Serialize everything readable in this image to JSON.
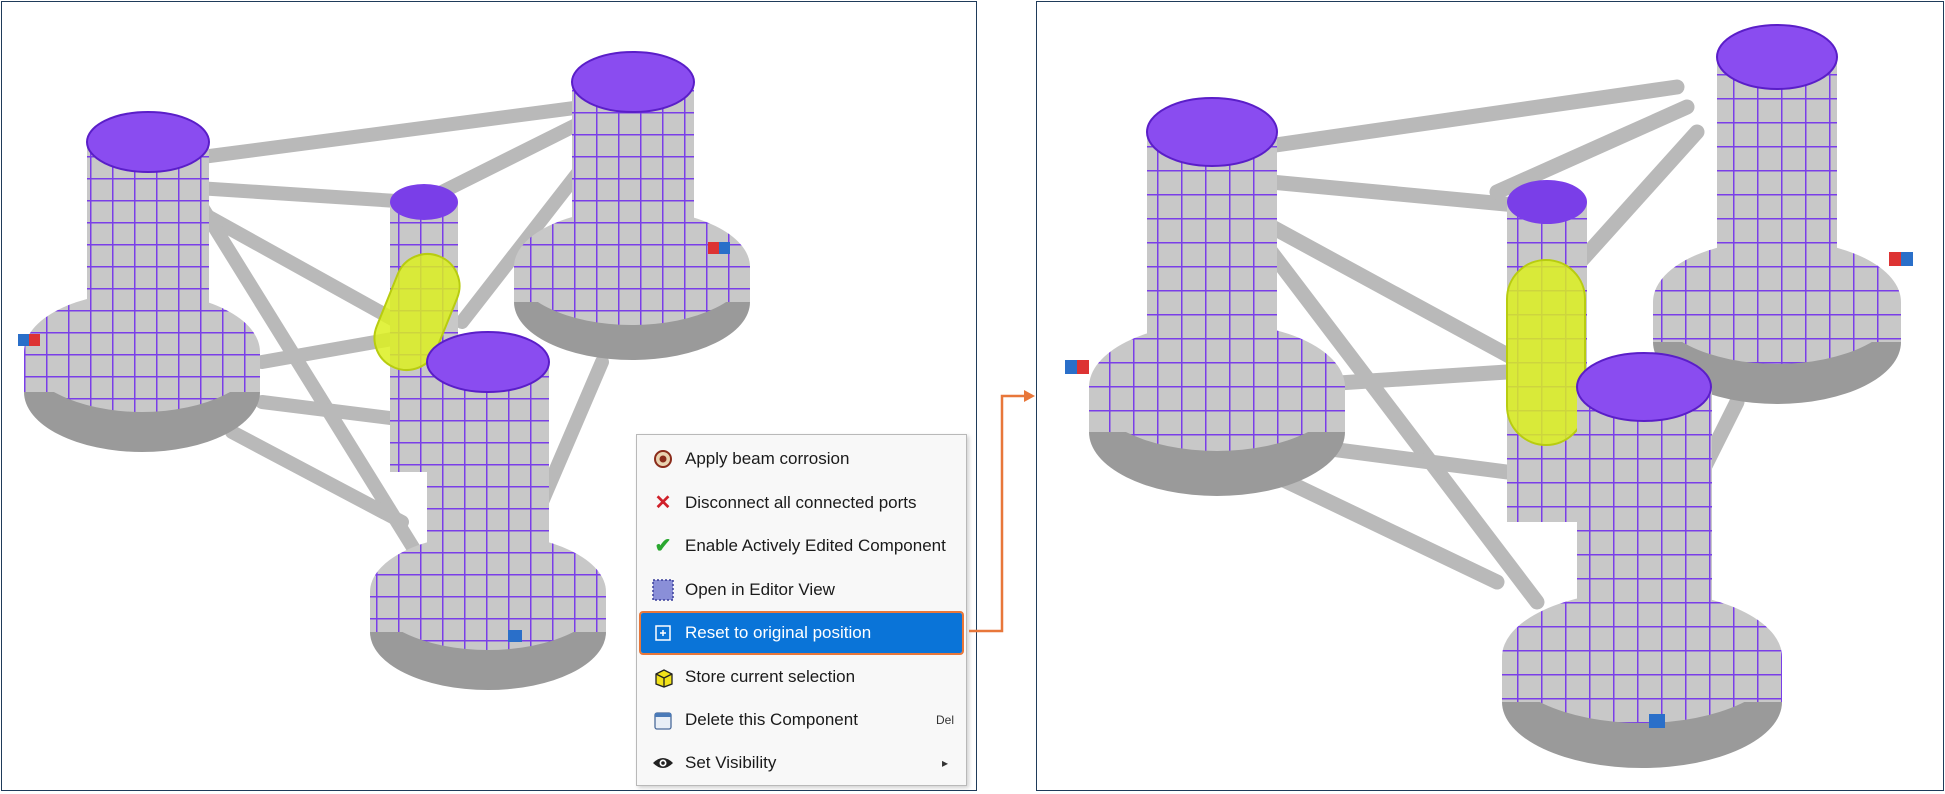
{
  "context_menu": {
    "items": [
      {
        "label": "Apply beam corrosion",
        "icon": "corrosion-icon"
      },
      {
        "label": "Disconnect all connected ports",
        "icon": "close-x-icon"
      },
      {
        "label": "Enable Actively Edited Component",
        "icon": "checkmark-icon"
      },
      {
        "label": "Open in Editor View",
        "icon": "editor-grid-icon"
      },
      {
        "label": "Reset to original position",
        "icon": "reset-position-icon",
        "highlighted": true
      },
      {
        "label": "Store current selection",
        "icon": "store-cube-icon"
      },
      {
        "label": "Delete this Component",
        "icon": "delete-icon",
        "shortcut": "Del"
      },
      {
        "label": "Set Visibility",
        "icon": "eye-icon",
        "submenu_arrow": "▸"
      }
    ]
  },
  "colors": {
    "mesh_purple": "#7a3ee8",
    "column_gray": "#c8c8c8",
    "selected_yellow": "#dcf020",
    "highlight_blue": "#0a74d8",
    "connector_orange": "#e8773a",
    "frame_navy": "#1f3b5a"
  }
}
